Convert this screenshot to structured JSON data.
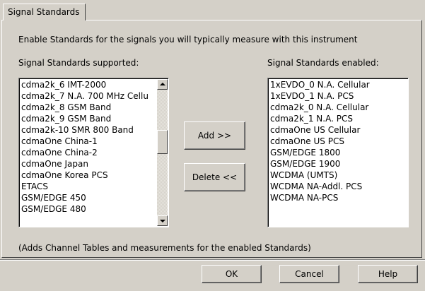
{
  "tab": {
    "label": "Signal Standards"
  },
  "instructions": "Enable Standards for the signals you will typically measure with this instrument",
  "supported": {
    "label": "Signal Standards supported:",
    "items": [
      "cdma2k_6 IMT-2000",
      "cdma2k_7 N.A. 700 MHz Cellu",
      "cdma2k_8 GSM Band",
      "cdma2k_9 GSM Band",
      "cdma2k-10 SMR 800 Band",
      "cdmaOne China-1",
      "cdmaOne China-2",
      "cdmaOne Japan",
      "cdmaOne Korea PCS",
      "ETACS",
      "GSM/EDGE 450",
      "GSM/EDGE 480"
    ]
  },
  "enabled": {
    "label": "Signal Standards enabled:",
    "items": [
      "1xEVDO_0 N.A. Cellular",
      "1xEVDO_1 N.A. PCS",
      "cdma2k_0 N.A. Cellular",
      "cdma2k_1 N.A. PCS",
      "cdmaOne US Cellular",
      "cdmaOne US PCS",
      "GSM/EDGE 1800",
      "GSM/EDGE 1900",
      "WCDMA (UMTS)",
      "WCDMA NA-Addl. PCS",
      "WCDMA NA-PCS"
    ]
  },
  "buttons": {
    "add": "Add >>",
    "delete": "Delete <<",
    "ok": "OK",
    "cancel": "Cancel",
    "help": "Help"
  },
  "footnote": "(Adds Channel Tables and measurements for the enabled Standards)",
  "icons": {
    "scroll_up": "up-arrow-icon",
    "scroll_down": "down-arrow-icon"
  }
}
